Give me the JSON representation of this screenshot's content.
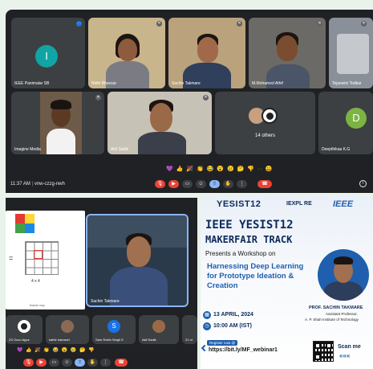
{
  "top_meeting": {
    "participants": [
      {
        "name": "IEEE Panimalar SB",
        "initial": "I"
      },
      {
        "name": "Nidhi Bhavsar"
      },
      {
        "name": "Sachin Takmare"
      },
      {
        "name": "M.Mohamed Athif"
      },
      {
        "name": "Tejaswini Todkar"
      },
      {
        "name": "Imagine Media"
      },
      {
        "name": "Akil Sadik"
      },
      {
        "name": "14 others"
      },
      {
        "name": "Deepthikaa K.G",
        "initial": "D"
      }
    ],
    "time": "11:37 AM",
    "meeting_code": "vnw-czzg-nwh",
    "info_icon": "i"
  },
  "bottom_meeting": {
    "slide_text": "4 x 4",
    "slide_caption": "feature map",
    "speaker_name": "Sachin Takmare",
    "participants": [
      {
        "name": "ZG Zoco Apps"
      },
      {
        "name": "kathir kamavel"
      },
      {
        "name": "Sam Robin Singh E",
        "initial": "S"
      },
      {
        "name": "Akil Sadik"
      },
      {
        "name": "21 ot"
      }
    ]
  },
  "poster": {
    "logo_left": "YESIST12",
    "logo_mid": "IEXPL RE",
    "logo_right": "IEEE",
    "title_line1": "IEEE YESIST12",
    "title_line2": "MAKERFAIR TRACK",
    "presents": "Presents a Workshop on",
    "topic_line1": "Harnessing Deep Learning",
    "topic_line2": "for Prototype Ideation &",
    "topic_line3": "Creation",
    "speaker": "PROF. SACHIN TAKMARE",
    "speaker_role1": "Assistant Professor,",
    "speaker_role2": "A. P. Shah Institute of Technology",
    "date": "13 APRIL, 2024",
    "time": "10:00 AM (IST)",
    "register": "Register now @",
    "link": "https://bit.ly/MF_webinar1",
    "scan": "Scan me",
    "colors": {
      "navy": "#0b2a5b",
      "accent": "#1f5fae",
      "green": "#1ea86a"
    }
  }
}
